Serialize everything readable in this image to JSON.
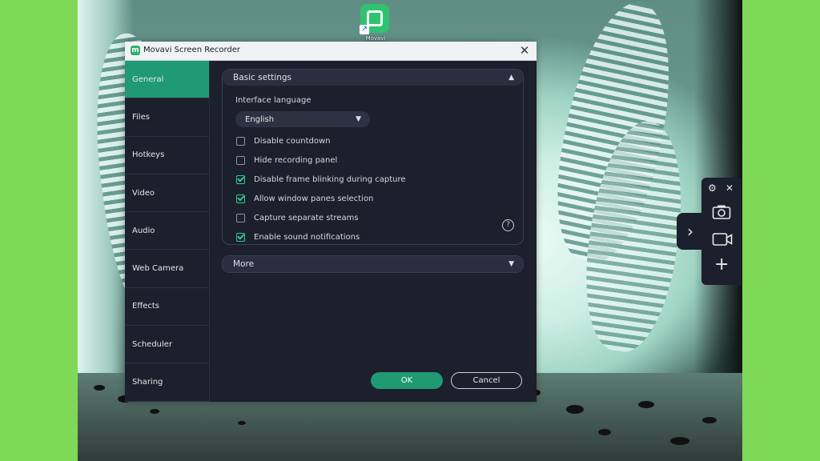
{
  "desktop": {
    "shortcut_label": "Movavi"
  },
  "dialog": {
    "title": "Movavi Screen Recorder",
    "close_glyph": "✕",
    "sidebar": [
      {
        "label": "General",
        "active": true
      },
      {
        "label": "Files",
        "active": false
      },
      {
        "label": "Hotkeys",
        "active": false
      },
      {
        "label": "Video",
        "active": false
      },
      {
        "label": "Audio",
        "active": false
      },
      {
        "label": "Web Camera",
        "active": false
      },
      {
        "label": "Effects",
        "active": false
      },
      {
        "label": "Scheduler",
        "active": false
      },
      {
        "label": "Sharing",
        "active": false
      }
    ],
    "basic": {
      "header": "Basic settings",
      "language_label": "Interface language",
      "language_value": "English",
      "options": [
        {
          "label": "Disable countdown",
          "checked": false
        },
        {
          "label": "Hide recording panel",
          "checked": false
        },
        {
          "label": "Disable frame blinking during capture",
          "checked": true
        },
        {
          "label": "Allow window panes selection",
          "checked": true
        },
        {
          "label": "Capture separate streams",
          "checked": false
        },
        {
          "label": "Enable sound notifications",
          "checked": true
        }
      ],
      "help_glyph": "?"
    },
    "more": {
      "header": "More"
    },
    "buttons": {
      "ok": "OK",
      "cancel": "Cancel"
    }
  },
  "icons": {
    "chevron_up": "▲",
    "chevron_down": "▼",
    "panel_expand": "›",
    "settings": "⚙",
    "close": "✕",
    "add": "+"
  },
  "colors": {
    "accent": "#1f9a72",
    "check": "#2dcf96",
    "dialog_bg": "#1c1f2c",
    "page_bg": "#7ed957"
  }
}
